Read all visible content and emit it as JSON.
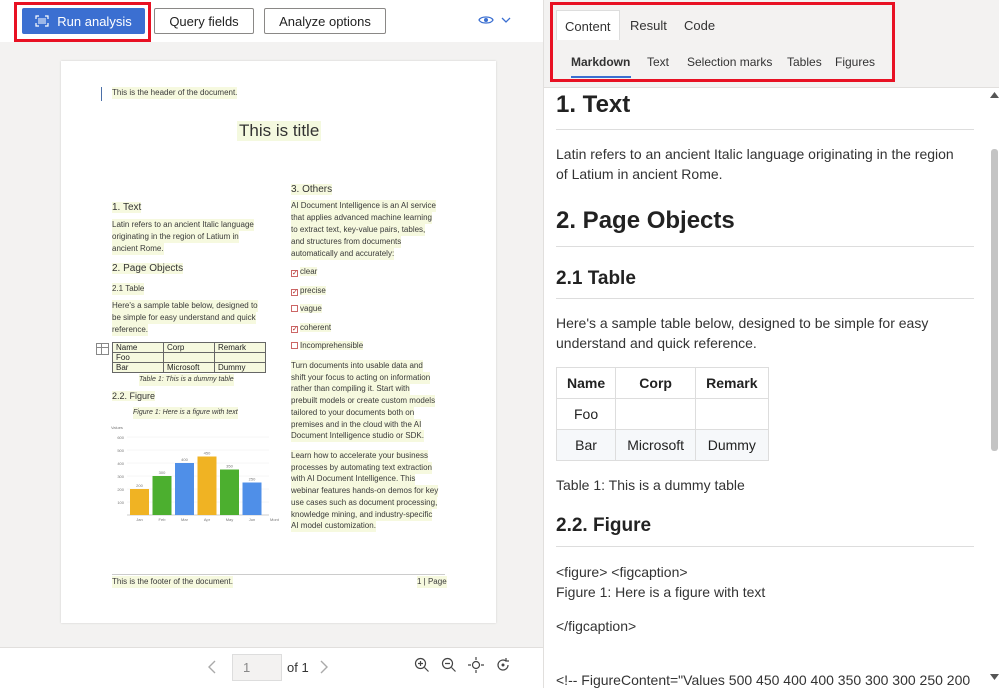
{
  "toolbar": {
    "run_label": "Run analysis",
    "query_label": "Query fields",
    "options_label": "Analyze options"
  },
  "document": {
    "header": "This is the header of the document.",
    "title": "This is title",
    "sec1_h": "1. Text",
    "sec1_p": [
      "Latin refers to an ancient Italic language",
      "originating in the region of Latium in",
      "ancient Rome."
    ],
    "sec2_h": "2. Page Objects",
    "sec21_h": "2.1 Table",
    "sec21_p": [
      "Here's a sample table below, designed to",
      "be simple for easy understand and quick",
      "reference."
    ],
    "table": [
      [
        "Name",
        "Corp",
        "Remark"
      ],
      [
        "Foo",
        "",
        ""
      ],
      [
        "Bar",
        "Microsoft",
        "Dummy"
      ]
    ],
    "table_caption": "Table 1: This is a dummy table",
    "sec22_h": "2.2. Figure",
    "figure_caption": "Figure 1: Here is a figure with text",
    "sec3_h": "3. Others",
    "sec3_p": [
      "AI Document Intelligence is an AI service",
      "that applies advanced machine learning",
      "to extract text, key-value pairs, tables,",
      "and structures from documents",
      "automatically and accurately:"
    ],
    "checks": [
      {
        "label": "clear",
        "checked": true
      },
      {
        "label": "precise",
        "checked": true
      },
      {
        "label": "vague",
        "checked": false
      },
      {
        "label": "coherent",
        "checked": true
      },
      {
        "label": "Incomprehensible",
        "checked": false
      }
    ],
    "para_a": [
      "Turn documents into usable data and",
      "shift your focus to acting on information",
      "rather than compiling it. Start with",
      "prebuilt models or create custom models",
      "tailored to your documents both on",
      "premises and in the cloud with the AI",
      "Document Intelligence studio or SDK."
    ],
    "para_b": [
      "Learn how to accelerate your business",
      "processes by automating text extraction",
      "with AI Document Intelligence. This",
      "webinar features hands-on demos for key",
      "use cases such as document processing,",
      "knowledge mining, and industry-specific",
      "AI model customization."
    ],
    "footer": "This is the footer of the document.",
    "page_label": "1 | Page"
  },
  "chart_data": {
    "type": "bar",
    "categories": [
      "Jan",
      "Feb",
      "Mar",
      "Apr",
      "May",
      "Jun"
    ],
    "values": [
      200,
      300,
      400,
      450,
      350,
      250
    ],
    "colors": [
      "#f0b323",
      "#4caf2f",
      "#4f8fe8",
      "#f0b323",
      "#4caf2f",
      "#4f8fe8"
    ],
    "ylabel": "Values",
    "xlabel": "Months",
    "yticks": [
      100,
      200,
      300,
      400,
      500,
      600
    ],
    "ylim": [
      0,
      600
    ]
  },
  "viewer": {
    "page_value": "1",
    "of_label": "of 1"
  },
  "right": {
    "tabs": [
      "Content",
      "Result",
      "Code"
    ],
    "subtabs": [
      "Markdown",
      "Text",
      "Selection marks",
      "Tables",
      "Figures"
    ],
    "h1_text": "1. Text",
    "p_latin": "Latin refers to an ancient Italic language originating in the region of Latium in ancient Rome.",
    "h1_objects": "2. Page Objects",
    "h2_table": "2.1 Table",
    "p_table": "Here's a sample table below, designed to be simple for easy understand and quick reference.",
    "table_headers": [
      "Name",
      "Corp",
      "Remark"
    ],
    "table_rows": [
      [
        "Foo",
        "",
        ""
      ],
      [
        "Bar",
        "Microsoft",
        "Dummy"
      ]
    ],
    "p_caption": "Table 1: This is a dummy table",
    "h2_figure": "2.2. Figure",
    "p_fig1": "<figure> <figcaption>",
    "p_fig2": "Figure 1: Here is a figure with text",
    "p_fig3": "</figcaption>",
    "p_fig4": "<!-- FigureContent=\"Values 500 450 400 400 350 300 300 250 200"
  }
}
